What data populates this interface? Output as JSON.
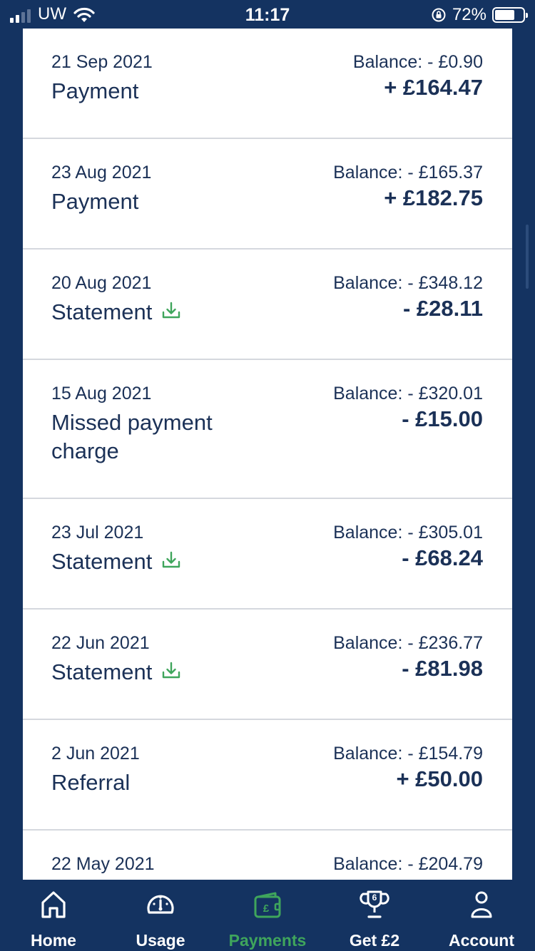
{
  "status_bar": {
    "carrier": "UW",
    "time": "11:17",
    "battery": "72%",
    "battery_level": 0.72
  },
  "colors": {
    "navy": "#143361",
    "text": "#1b3157",
    "accent_green": "#3fa55c",
    "divider": "#d5d8de"
  },
  "transactions": [
    {
      "date": "21 Sep 2021",
      "title": "Payment",
      "balance": "Balance: - £0.90",
      "amount": "+ £164.47",
      "download": false
    },
    {
      "date": "23 Aug 2021",
      "title": "Payment",
      "balance": "Balance: - £165.37",
      "amount": "+ £182.75",
      "download": false
    },
    {
      "date": "20 Aug 2021",
      "title": "Statement",
      "balance": "Balance: - £348.12",
      "amount": "- £28.11",
      "download": true
    },
    {
      "date": "15 Aug 2021",
      "title": "Missed payment charge",
      "balance": "Balance: - £320.01",
      "amount": "- £15.00",
      "download": false
    },
    {
      "date": "23 Jul 2021",
      "title": "Statement",
      "balance": "Balance: - £305.01",
      "amount": "- £68.24",
      "download": true
    },
    {
      "date": "22 Jun 2021",
      "title": "Statement",
      "balance": "Balance: - £236.77",
      "amount": "- £81.98",
      "download": true
    },
    {
      "date": "2 Jun 2021",
      "title": "Referral",
      "balance": "Balance: - £154.79",
      "amount": "+ £50.00",
      "download": false
    },
    {
      "date": "22 May 2021",
      "title": "",
      "balance": "Balance: - £204.79",
      "amount": "",
      "download": false
    }
  ],
  "tabs": [
    {
      "label": "Home",
      "icon": "home-icon",
      "active": false
    },
    {
      "label": "Usage",
      "icon": "gauge-icon",
      "active": false
    },
    {
      "label": "Payments",
      "icon": "wallet-icon",
      "active": true
    },
    {
      "label": "Get £2",
      "icon": "trophy-icon",
      "active": false
    },
    {
      "label": "Account",
      "icon": "person-icon",
      "active": false
    }
  ]
}
